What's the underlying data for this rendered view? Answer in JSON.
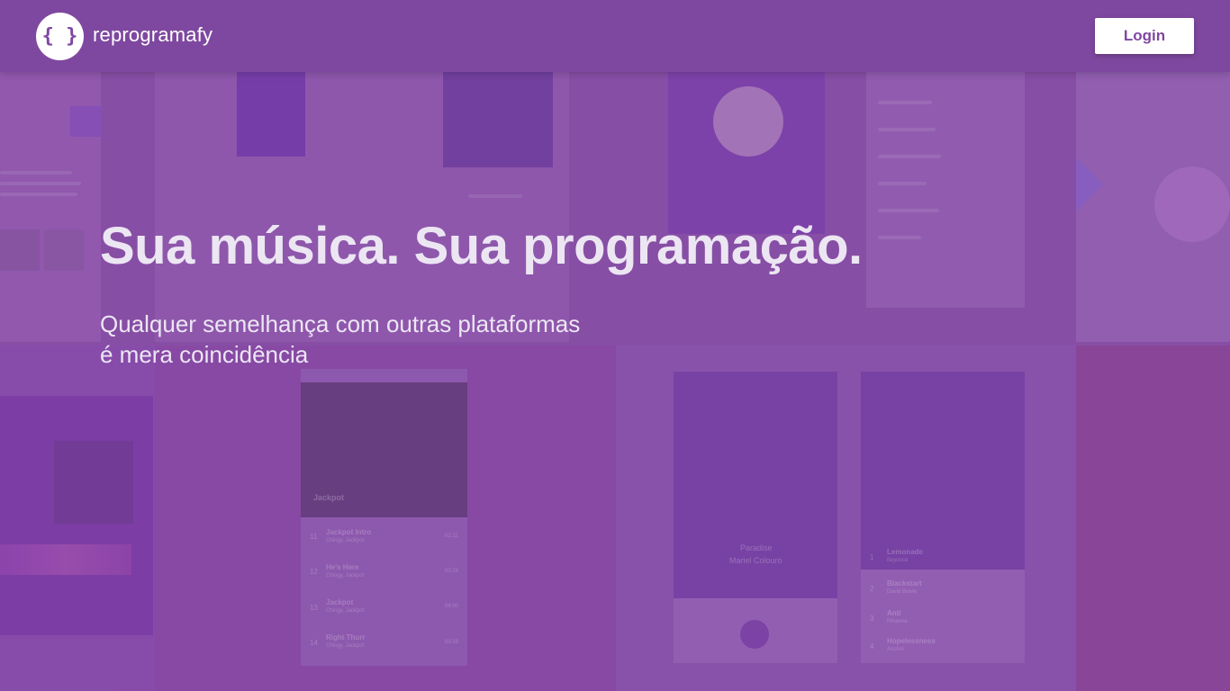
{
  "header": {
    "logo_glyph": "{ }",
    "brand": "reprogramafy",
    "login_label": "Login"
  },
  "hero": {
    "title": "Sua música. Sua programação.",
    "subtitle_line1": "Qualquer semelhança com outras plataformas",
    "subtitle_line2": "é mera coincidência"
  },
  "colors": {
    "header_bg": "#7f48a0",
    "accent": "#7f48a0",
    "page_bg": "#8a52a8",
    "hero_text": "#ece6f3"
  },
  "background_collage": {
    "tracks": [
      {
        "num": "11",
        "title": "Jackpot Intro",
        "artist": "Chingy, Jackpot",
        "time": "02:11"
      },
      {
        "num": "12",
        "title": "He's Here",
        "artist": "Chingy, Jackpot",
        "time": "03:24"
      },
      {
        "num": "13",
        "title": "Jackpot",
        "artist": "Chingy, Jackpot",
        "time": "04:00"
      },
      {
        "num": "14",
        "title": "Right Thurr",
        "artist": "Chingy, Jackpot",
        "time": "03:58"
      }
    ],
    "album_label": "Jackpot",
    "player_title": "Paradise",
    "player_artist": "Mariel Colouro",
    "playlist": [
      {
        "num": "1",
        "title": "Lemonade",
        "artist": "Beyoncé"
      },
      {
        "num": "2",
        "title": "Blackstart",
        "artist": "David Bowie"
      },
      {
        "num": "3",
        "title": "Anti",
        "artist": "Rihanna"
      },
      {
        "num": "4",
        "title": "Hopelessness",
        "artist": "Anohni"
      }
    ]
  }
}
